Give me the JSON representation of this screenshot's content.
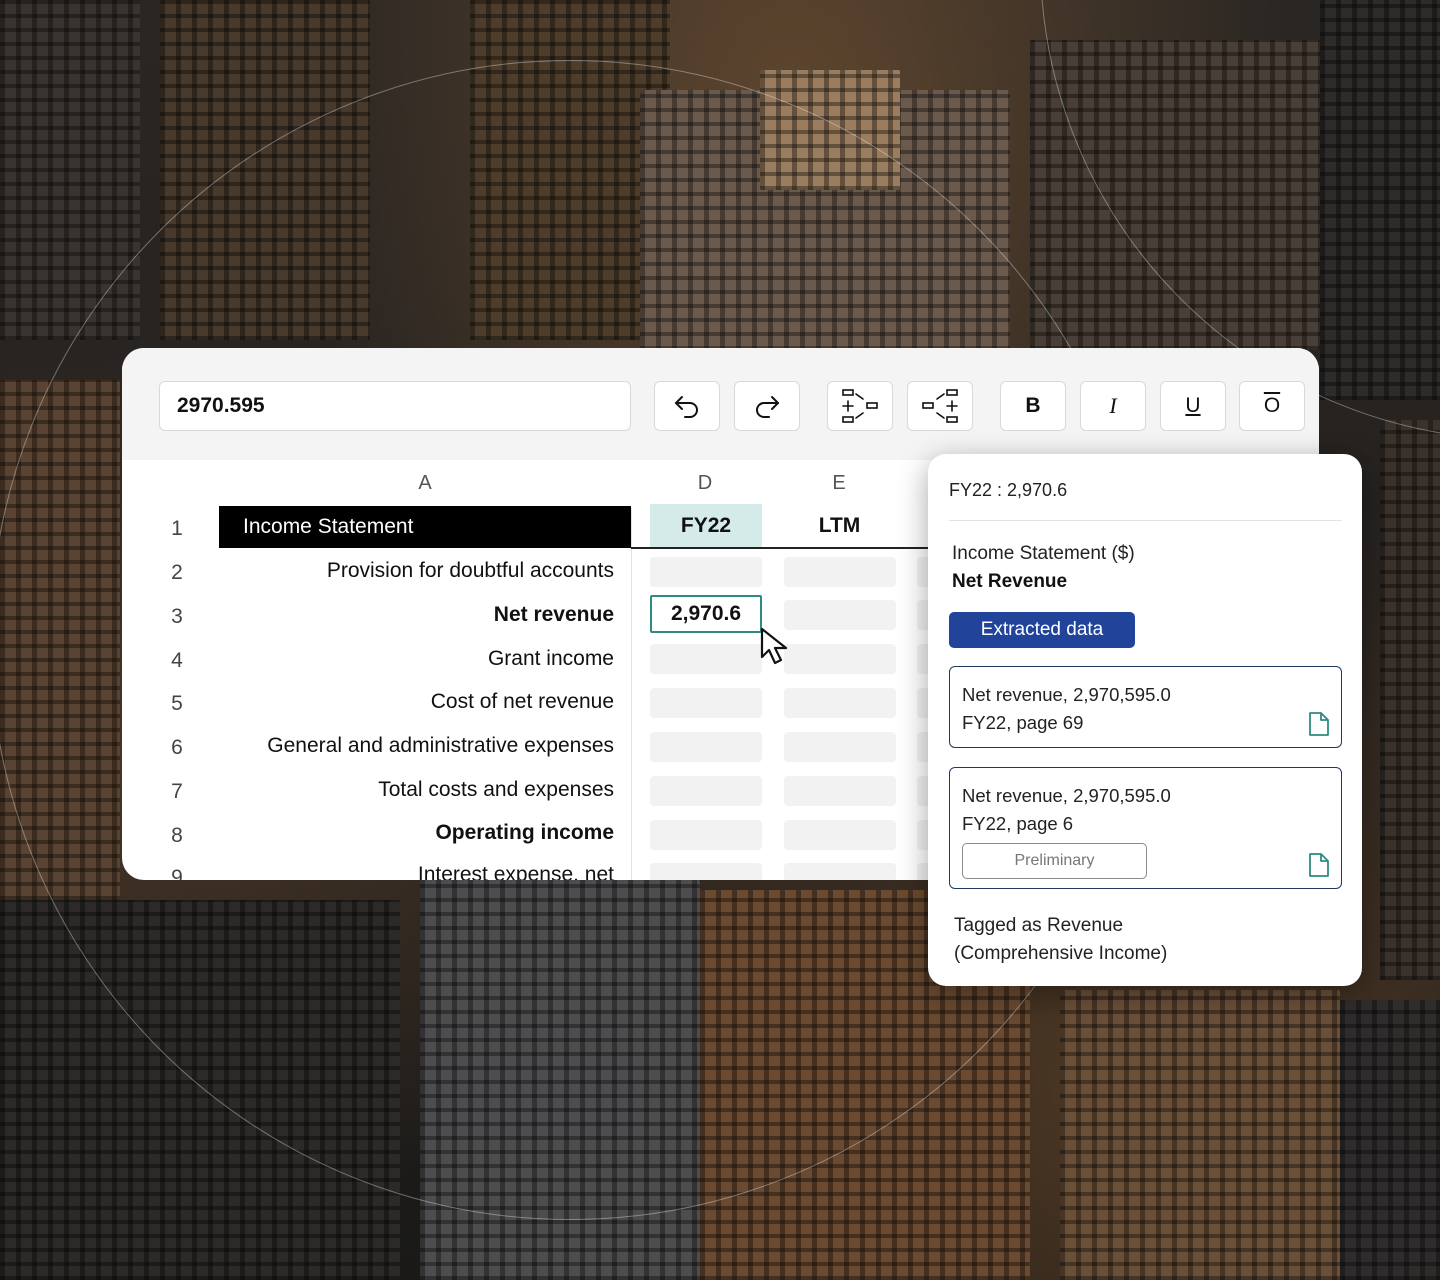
{
  "toolbar": {
    "formula_value": "2970.595",
    "bold_label": "B",
    "italic_label": "I",
    "underline_label": "U",
    "overline_label": "O"
  },
  "sheet": {
    "columns": [
      "A",
      "D",
      "E"
    ],
    "row_numbers": [
      "1",
      "2",
      "3",
      "4",
      "5",
      "6",
      "7",
      "8",
      "9"
    ],
    "header_title": "Income Statement",
    "header_fy": "FY22",
    "header_ltm": "LTM",
    "rows": [
      "Provision for doubtful accounts",
      "Net revenue",
      "Grant income",
      "Cost of net revenue",
      "General and administrative expenses",
      "Total costs and expenses",
      "Operating income",
      "Interest expense, net"
    ],
    "selected_cell_value": "2,970.6"
  },
  "popup": {
    "header": "FY22 : 2,970.6",
    "section_title": "Income Statement ($)",
    "section_subtitle": "Net Revenue",
    "extracted_button": "Extracted data",
    "sources": [
      {
        "line1": "Net revenue, 2,970,595.0",
        "line2": "FY22, page 69"
      },
      {
        "line1": "Net revenue, 2,970,595.0",
        "line2": "FY22, page 6",
        "badge": "Preliminary"
      }
    ],
    "tag_line1": "Tagged as Revenue",
    "tag_line2": "(Comprehensive Income)"
  },
  "icons": {
    "undo": "undo-icon",
    "redo": "redo-icon",
    "insert_row": "insert-row-icon",
    "insert_column": "insert-column-icon",
    "document": "document-icon",
    "cursor": "cursor-icon"
  },
  "colors": {
    "accent_teal": "#2e8a82",
    "header_fill": "#d5ebea",
    "button_blue": "#22439a",
    "source_border": "#22395e"
  }
}
